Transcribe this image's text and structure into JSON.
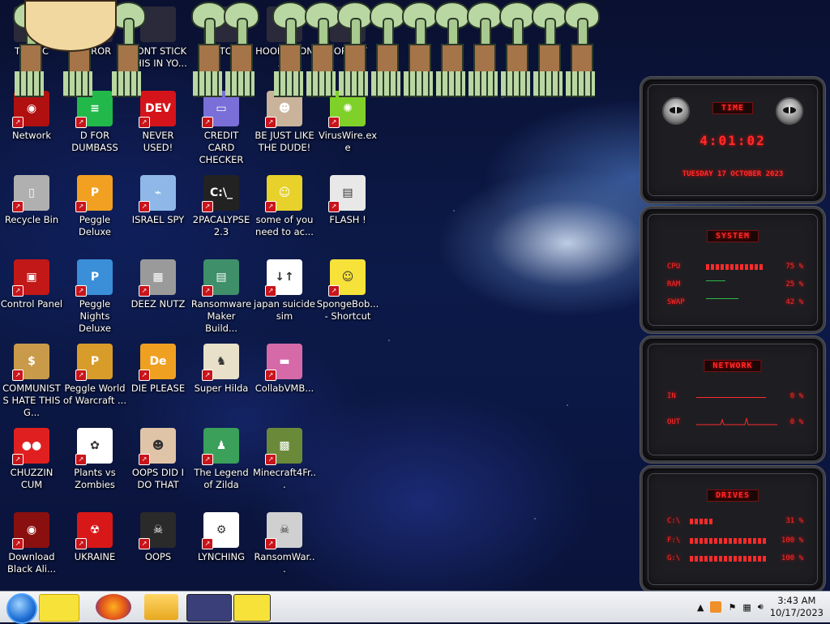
{
  "desktop": {
    "top_row_labels": [
      "This PC",
      "ERROR",
      "DONT STICK THIS IN YO...",
      "EDITOR",
      "HOOKED ON XO",
      "FORMAT"
    ],
    "icons": [
      {
        "id": "network",
        "label": "Network",
        "color": "#b01010",
        "glyph": "◉"
      },
      {
        "id": "d-for-dumbass",
        "label": "D FOR DUMBASS",
        "color": "#22b84a",
        "glyph": "≡"
      },
      {
        "id": "never-used",
        "label": "NEVER USED!",
        "color": "#d4141a",
        "glyph": "DEV"
      },
      {
        "id": "credit-card-checker",
        "label": "CREDIT CARD CHECKER",
        "color": "#7a6fd8",
        "glyph": "▭"
      },
      {
        "id": "be-just-like-the-dude",
        "label": "BE JUST LIKE THE DUDE!",
        "color": "#c9b39a",
        "glyph": "☻"
      },
      {
        "id": "viruswire",
        "label": "VirusWire.exe",
        "color": "#7fd12a",
        "glyph": "✺"
      },
      {
        "id": "recycle-bin",
        "label": "Recycle Bin",
        "color": "#b0b0b0",
        "glyph": "▯"
      },
      {
        "id": "peggle-deluxe",
        "label": "Peggle Deluxe",
        "color": "#f2a021",
        "glyph": "P"
      },
      {
        "id": "israel-spy",
        "label": "ISRAEL SPY",
        "color": "#8fb8e8",
        "glyph": "⌁"
      },
      {
        "id": "2pacalypse",
        "label": "2PACALYPSE 2.3",
        "color": "#222222",
        "glyph": "C:\\_"
      },
      {
        "id": "some-of-you",
        "label": "some of you need to ac...",
        "color": "#e7d12a",
        "glyph": "☺"
      },
      {
        "id": "flash",
        "label": "FLASH !",
        "color": "#e8e8e8",
        "glyph": "▤"
      },
      {
        "id": "control-panel",
        "label": "Control Panel",
        "color": "#c21818",
        "glyph": "▣"
      },
      {
        "id": "peggle-nights",
        "label": "Peggle Nights Deluxe",
        "color": "#3a8fd8",
        "glyph": "P"
      },
      {
        "id": "deez-nutz",
        "label": "DEEZ NUTZ",
        "color": "#9a9a9a",
        "glyph": "▦"
      },
      {
        "id": "ransomware-maker",
        "label": "Ransomware Maker Build...",
        "color": "#3f8f6a",
        "glyph": "▤"
      },
      {
        "id": "japan-suicide-sim",
        "label": "japan suicide sim",
        "color": "#ffffff",
        "glyph": "↓↑"
      },
      {
        "id": "spongebob-shortcut",
        "label": "SpongeBob... - Shortcut",
        "color": "#f7e23a",
        "glyph": "☺"
      },
      {
        "id": "communists",
        "label": "COMMUNISTS HATE THIS G...",
        "color": "#c89a4a",
        "glyph": "$"
      },
      {
        "id": "peggle-world-warcraft",
        "label": "Peggle World of Warcraft ...",
        "color": "#d89c2a",
        "glyph": "P"
      },
      {
        "id": "die-please",
        "label": "DIE PLEASE",
        "color": "#f0a020",
        "glyph": "De"
      },
      {
        "id": "super-hilda",
        "label": "Super Hilda",
        "color": "#e8e0c8",
        "glyph": "♞"
      },
      {
        "id": "collabvmb",
        "label": "CollabVMB...",
        "color": "#d66aa8",
        "glyph": "▬"
      },
      {
        "id": "chuzzin-cum",
        "label": "CHUZZIN CUM",
        "color": "#e02020",
        "glyph": "●●"
      },
      {
        "id": "plants-vs-zombies",
        "label": "Plants vs Zombies",
        "color": "#ffffff",
        "glyph": "✿"
      },
      {
        "id": "oops-did-i-do-that",
        "label": "OOPS DID I DO THAT",
        "color": "#e0c4a8",
        "glyph": "☻"
      },
      {
        "id": "legend-of-zilda",
        "label": "The Legend of Zilda",
        "color": "#3aa05a",
        "glyph": "♟"
      },
      {
        "id": "minecraft4fr",
        "label": "Minecraft4Fr...",
        "color": "#6a8a3a",
        "glyph": "▩"
      },
      {
        "id": "download-black-ali",
        "label": "Download Black Ali...",
        "color": "#8a1010",
        "glyph": "◉"
      },
      {
        "id": "ukraine",
        "label": "UKRAINE",
        "color": "#d81818",
        "glyph": "☢"
      },
      {
        "id": "oops",
        "label": "OOPS",
        "color": "#2a2a2a",
        "glyph": "☠"
      },
      {
        "id": "lynching",
        "label": "LYNCHING",
        "color": "#ffffff",
        "glyph": "⚙"
      },
      {
        "id": "ransomwar",
        "label": "RansomWar...",
        "color": "#d0d0d0",
        "glyph": "☠"
      }
    ]
  },
  "widget": {
    "time": {
      "title": "TIME",
      "clock": "4:01:02",
      "date": "TUESDAY 17 OCTOBER 2023"
    },
    "system": {
      "title": "SYSTEM",
      "rows": [
        {
          "key": "CPU",
          "value": "75 %",
          "level": 0.75
        },
        {
          "key": "RAM",
          "value": "25 %",
          "level": 0.25
        },
        {
          "key": "SWAP",
          "value": "42 %",
          "level": 0.42
        }
      ]
    },
    "network": {
      "title": "NETWORK",
      "rows": [
        {
          "key": "IN",
          "value": "0 %"
        },
        {
          "key": "OUT",
          "value": "0 %"
        }
      ]
    },
    "drives": {
      "title": "DRIVES",
      "rows": [
        {
          "key": "C:\\",
          "value": "31 %",
          "level": 0.31
        },
        {
          "key": "F:\\",
          "value": "100 %",
          "level": 1.0
        },
        {
          "key": "G:\\",
          "value": "100 %",
          "level": 1.0
        }
      ]
    }
  },
  "taskbar": {
    "time": "3:43 AM",
    "date": "10/17/2023"
  }
}
